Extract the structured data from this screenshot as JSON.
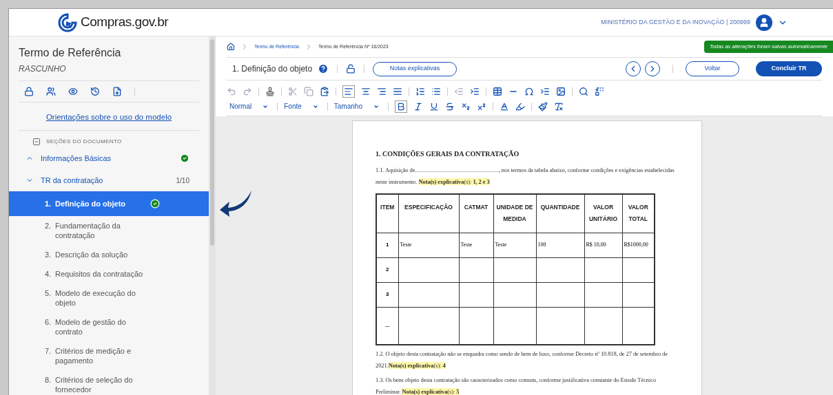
{
  "header": {
    "logo_text": "Compras.gov.br",
    "organization": "MINISTÉRIO DA GESTÃO E DA INOVAÇÃO | 200999"
  },
  "sidebar": {
    "title": "Termo de Referência",
    "status": "RASCUNHO",
    "guide_link": "Orientações sobre o uso do modelo",
    "sections_header": "SEÇÕES DO DOCUMENTO",
    "groups": [
      {
        "label": "Informações Básicas",
        "expanded": false,
        "done": true
      },
      {
        "label": "TR da contratação",
        "expanded": true,
        "count": "1/10",
        "children": [
          {
            "number": "1.",
            "label": "Definição do objeto",
            "selected": true,
            "done": true
          },
          {
            "number": "2.",
            "label": "Fundamentação da contratação",
            "selected": false,
            "done": false
          },
          {
            "number": "3.",
            "label": "Descrição da solução",
            "selected": false,
            "done": false
          },
          {
            "number": "4.",
            "label": "Requisitos da contratação",
            "selected": false,
            "done": false
          },
          {
            "number": "5.",
            "label": "Modelo de execução do objeto",
            "selected": false,
            "done": false
          },
          {
            "number": "6.",
            "label": "Modelo de gestão do contrato",
            "selected": false,
            "done": false
          },
          {
            "number": "7.",
            "label": "Critérios de medição e pagamento",
            "selected": false,
            "done": false
          },
          {
            "number": "8.",
            "label": "Critérios de seleção do fornecedor",
            "selected": false,
            "done": false
          }
        ]
      }
    ]
  },
  "breadcrumb": [
    "Termo de Referência",
    "Termo de Referência Nº 16/2023"
  ],
  "save_status": "Todas as alterações foram salvas automaticamente",
  "section_title": "1. Definição do objeto",
  "notes_button": "Notas explicativas",
  "back_button": "Voltar",
  "finish_button": "Concluir TR",
  "style_dropdowns": [
    "Normal",
    "Fonte",
    "Tamanho"
  ],
  "document": {
    "heading": "1. CONDIÇÕES GERAIS DA CONTRATAÇÃO",
    "paragraphs_before": [
      {
        "text": "1.1. Aquisição de............................................................, nos termos da tabela abaixo, conforme condições e exigências estabelecidas neste instrumento. ",
        "note": "**Nota(s) explicativa**(s): **1, 2 e 3**"
      }
    ],
    "table": {
      "columns": [
        "ITEM",
        "ESPECIFICAÇÃO",
        "CATMAT",
        "UNIDADE DE MEDIDA",
        "QUANTIDADE",
        "VALOR UNITÁRIO",
        "VALOR TOTAL"
      ],
      "rows": [
        [
          "1",
          "Teste",
          "Teste",
          "Teste",
          "100",
          "R$ 10,00",
          "R$1000,00"
        ],
        [
          "2"
        ],
        [
          "3"
        ],
        [
          "..."
        ]
      ]
    },
    "paragraphs_after": [
      {
        "text": "1.2. O objeto desta contratação não se enquadra como sendo de bem de luxo, conforme Decreto nº 10.818, de 27 de setembro de 2021.",
        "note": "**Nota(s) explicativa**(s): **4**"
      },
      {
        "text": "1.3. Os bens objeto desta contratação são caracterizados como comuns, conforme justificativa constante do Estudo Técnico Preliminar. ",
        "note": "**Nota(s) explicativa**(s): **5**"
      }
    ]
  }
}
